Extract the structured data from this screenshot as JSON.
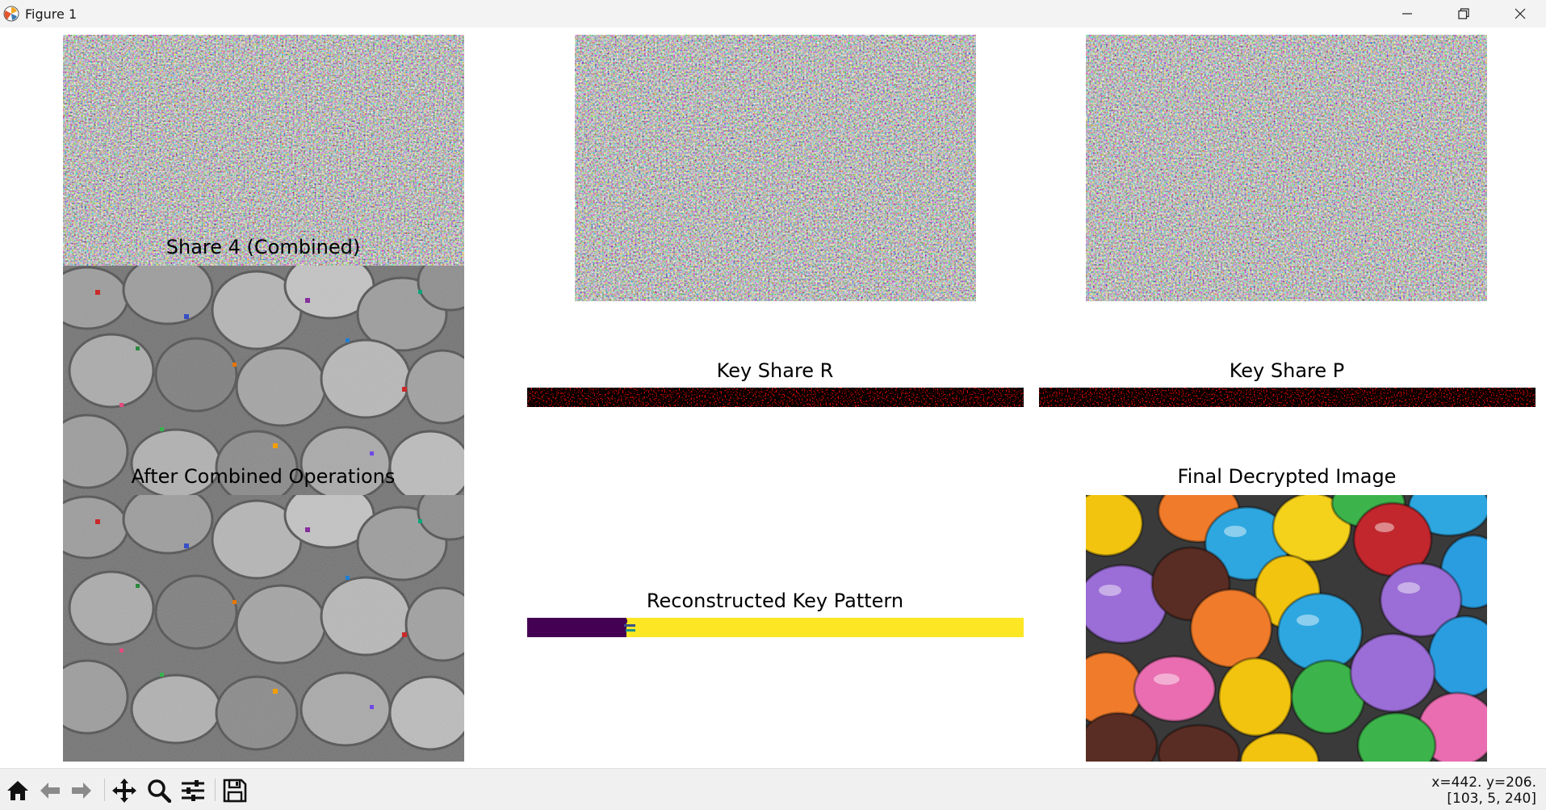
{
  "window": {
    "title": "Figure 1",
    "controls": {
      "minimize": "minimize-icon",
      "maximize": "restore-icon",
      "close": "close-icon"
    }
  },
  "figure": {
    "axes": [
      {
        "id": "share-top-left",
        "title": "",
        "content": "noise"
      },
      {
        "id": "share-top-middle",
        "title": "",
        "content": "noise"
      },
      {
        "id": "share-top-right",
        "title": "",
        "content": "noise"
      },
      {
        "id": "share-4-combined",
        "title": "Share 4 (Combined)",
        "content": "grayscale candy with noise"
      },
      {
        "id": "after-combined-ops",
        "title": "After Combined Operations",
        "content": "grayscale candy with noise"
      },
      {
        "id": "key-share-r",
        "title": "Key Share R",
        "content": "red dots on black"
      },
      {
        "id": "key-share-p",
        "title": "Key Share P",
        "content": "red dots on black"
      },
      {
        "id": "reconstructed-key",
        "title": "Reconstructed Key Pattern",
        "content": "purple then yellow bar"
      },
      {
        "id": "final-decrypted",
        "title": "Final Decrypted Image",
        "content": "colorful candy"
      }
    ],
    "colors": {
      "key_bg": "#000000",
      "key_dots": "#d10000",
      "pattern_low": "#440154",
      "pattern_high": "#fde725"
    }
  },
  "toolbar": {
    "tools": [
      "home-icon",
      "back-icon",
      "forward-icon",
      "pan-icon",
      "zoom-icon",
      "configure-subplots-icon",
      "save-icon"
    ],
    "coords_line1": "x=442. y=206.",
    "coords_line2": "[103, 5, 240]"
  }
}
